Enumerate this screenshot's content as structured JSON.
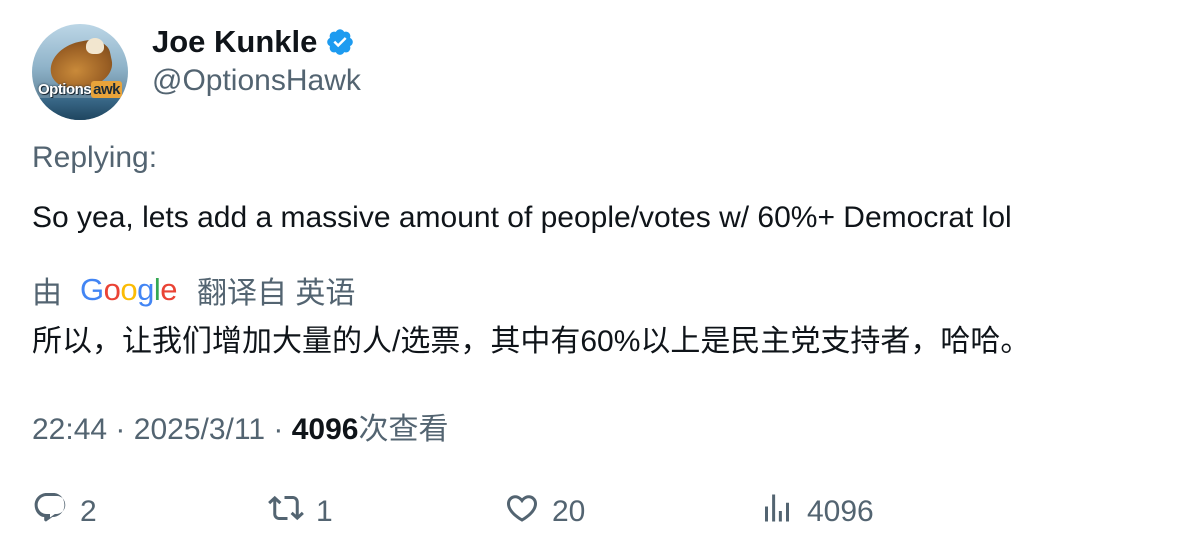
{
  "author": {
    "display_name": "Joe Kunkle",
    "handle": "@OptionsHawk",
    "avatar_text_part1": "Options",
    "avatar_text_part2": "awk",
    "verified": true,
    "verified_color": "#1d9bf0"
  },
  "tweet": {
    "replying_label": "Replying:",
    "text": "So yea, lets add a massive amount of people/votes w/ 60%+ Democrat lol"
  },
  "translation": {
    "by_label": "由",
    "provider": "Google",
    "from_label": "翻译自 英语",
    "text": "所以，让我们增加大量的人/选票，其中有60%以上是民主党支持者，哈哈。"
  },
  "meta": {
    "time": "22:44",
    "separator": "·",
    "date": "2025/3/11",
    "views_count": "4096",
    "views_label": "次查看"
  },
  "actions": {
    "reply_count": "2",
    "retweet_count": "1",
    "like_count": "20",
    "views_count": "4096"
  },
  "icons": {
    "reply": "reply-icon",
    "retweet": "retweet-icon",
    "like": "heart-icon",
    "views": "views-chart-icon",
    "verified": "verified-badge-icon"
  },
  "colors": {
    "text_primary": "#0f1419",
    "text_secondary": "#536471",
    "verified_blue": "#1d9bf0"
  }
}
